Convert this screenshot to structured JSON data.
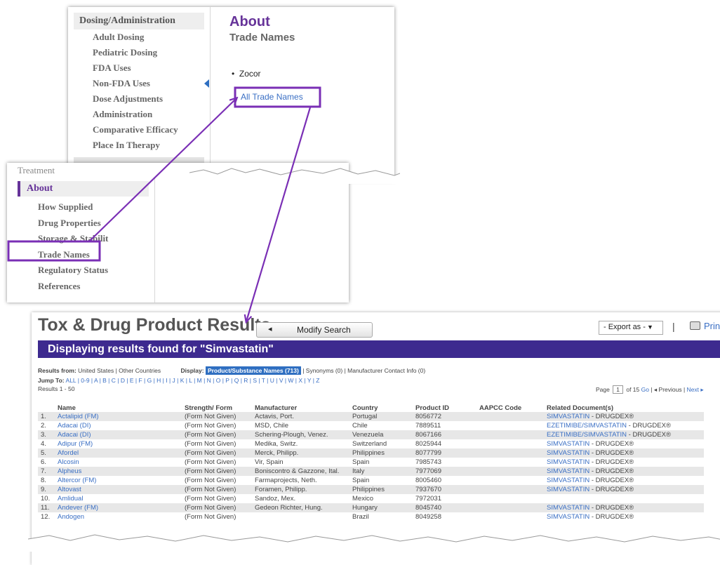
{
  "panel1": {
    "nav_header": "Dosing/Administration",
    "nav_items": [
      "Adult Dosing",
      "Pediatric Dosing",
      "FDA Uses",
      "Non-FDA Uses",
      "Dose Adjustments",
      "Administration",
      "Comparative Efficacy",
      "Place In Therapy"
    ],
    "about_title": "About",
    "trade_title": "Trade Names",
    "bullet_item": "Zocor",
    "all_trade_names": "All Trade Names"
  },
  "panel2": {
    "treatment": "Treatment",
    "about": "About",
    "items": [
      "How Supplied",
      "Drug Properties",
      "Storage & Stabilit",
      "Trade Names",
      "Regulatory Status",
      "References"
    ]
  },
  "results": {
    "title": "Tox & Drug Product Results",
    "modify_search": "Modify Search",
    "export": "- Export as -",
    "print": "Print",
    "banner": "Displaying results found for \"Simvastatin\"",
    "results_from_label": "Results from:",
    "results_from": "United States | Other Countries",
    "display_label": "Display:",
    "display_pill": "Product/Substance Names (713)",
    "display_rest": "| Synonyms (0) | Manufacturer Contact Info (0)",
    "jump_to": "Jump To:",
    "jump_letters": "ALL | 0-9 | A | B | C | D | E | F | G | H | I | J | K | L | M | N | O | P | Q | R | S | T | U | V | W | X | Y | Z",
    "results_count": "Results 1 - 50",
    "page_label": "Page",
    "page_value": "1",
    "page_of": "of 15",
    "go": "Go",
    "previous": "◂ Previous",
    "next": "Next ▸",
    "columns": [
      "Name",
      "Strength/ Form",
      "Manufacturer",
      "Country",
      "Product ID",
      "AAPCC Code",
      "Related Document(s)"
    ],
    "rows": [
      {
        "num": "1.",
        "name": "Actalipid (FM)",
        "form": "(Form Not Given)",
        "mfr": "Actavis, Port.",
        "country": "Portugal",
        "pid": "8056772",
        "aapcc": "",
        "doc": "SIMVASTATIN",
        "suffix": " - DRUGDEX®"
      },
      {
        "num": "2.",
        "name": "Adacai (DI)",
        "form": "(Form Not Given)",
        "mfr": "MSD, Chile",
        "country": "Chile",
        "pid": "7889511",
        "aapcc": "",
        "doc": "EZETIMIBE/SIMVASTATIN",
        "suffix": " - DRUGDEX®"
      },
      {
        "num": "3.",
        "name": "Adacai (DI)",
        "form": "(Form Not Given)",
        "mfr": "Schering-Plough, Venez.",
        "country": "Venezuela",
        "pid": "8067166",
        "aapcc": "",
        "doc": "EZETIMIBE/SIMVASTATIN",
        "suffix": " - DRUGDEX®"
      },
      {
        "num": "4.",
        "name": "Adipur (FM)",
        "form": "(Form Not Given)",
        "mfr": "Medika, Switz.",
        "country": "Switzerland",
        "pid": "8025944",
        "aapcc": "",
        "doc": "SIMVASTATIN",
        "suffix": " - DRUGDEX®"
      },
      {
        "num": "5.",
        "name": "Afordel",
        "form": "(Form Not Given)",
        "mfr": "Merck, Philipp.",
        "country": "Philippines",
        "pid": "8077799",
        "aapcc": "",
        "doc": "SIMVASTATIN",
        "suffix": " - DRUGDEX®"
      },
      {
        "num": "6.",
        "name": "Alcosin",
        "form": "(Form Not Given)",
        "mfr": "Vir, Spain",
        "country": "Spain",
        "pid": "7985743",
        "aapcc": "",
        "doc": "SIMVASTATIN",
        "suffix": " - DRUGDEX®"
      },
      {
        "num": "7.",
        "name": "Alpheus",
        "form": "(Form Not Given)",
        "mfr": "Boniscontro & Gazzone, Ital.",
        "country": "Italy",
        "pid": "7977069",
        "aapcc": "",
        "doc": "SIMVASTATIN",
        "suffix": " - DRUGDEX®"
      },
      {
        "num": "8.",
        "name": "Altercor (FM)",
        "form": "(Form Not Given)",
        "mfr": "Farmaprojects, Neth.",
        "country": "Spain",
        "pid": "8005460",
        "aapcc": "",
        "doc": "SIMVASTATIN",
        "suffix": " - DRUGDEX®"
      },
      {
        "num": "9.",
        "name": "Altovast",
        "form": "(Form Not Given)",
        "mfr": "Foramen, Philipp.",
        "country": "Philippines",
        "pid": "7937670",
        "aapcc": "",
        "doc": "SIMVASTATIN",
        "suffix": " - DRUGDEX®"
      },
      {
        "num": "10.",
        "name": "Amlidual",
        "form": "(Form Not Given)",
        "mfr": "Sandoz, Mex.",
        "country": "Mexico",
        "pid": "7972031",
        "aapcc": "",
        "doc": "",
        "suffix": ""
      },
      {
        "num": "11.",
        "name": "Andever (FM)",
        "form": "(Form Not Given)",
        "mfr": "Gedeon Richter, Hung.",
        "country": "Hungary",
        "pid": "8045740",
        "aapcc": "",
        "doc": "SIMVASTATIN",
        "suffix": " - DRUGDEX®"
      },
      {
        "num": "12.",
        "name": "Andogen",
        "form": "(Form Not Given)",
        "mfr": "",
        "country": "Brazil",
        "pid": "8049258",
        "aapcc": "",
        "doc": "SIMVASTATIN",
        "suffix": " - DRUGDEX®"
      }
    ]
  },
  "colors": {
    "purple": "#663399",
    "banner": "#3d2a8f",
    "link": "#3a6fc4",
    "highlight": "#7a2fb5"
  }
}
